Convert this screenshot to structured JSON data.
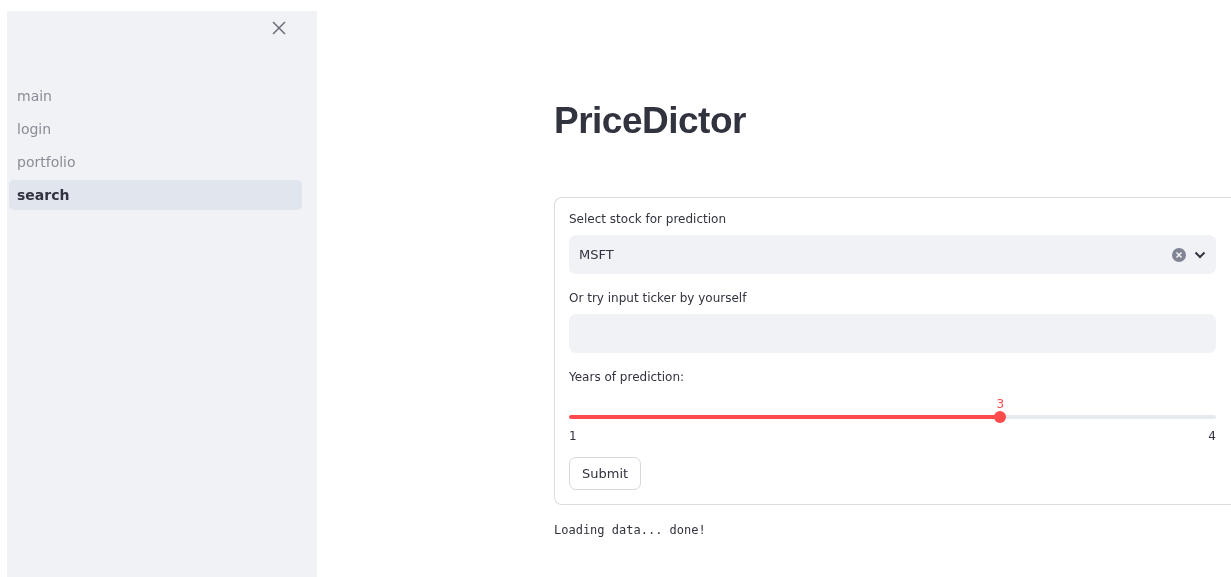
{
  "sidebar": {
    "items": [
      {
        "label": "main",
        "selected": false
      },
      {
        "label": "login",
        "selected": false
      },
      {
        "label": "portfolio",
        "selected": false
      },
      {
        "label": "search",
        "selected": true
      }
    ]
  },
  "title": "PriceDictor",
  "form": {
    "select": {
      "label": "Select stock for prediction",
      "value": "MSFT"
    },
    "ticker": {
      "label": "Or try input ticker by yourself"
    },
    "slider": {
      "label": "Years of prediction:",
      "reading": "3",
      "level": 0.6667,
      "min": "1",
      "max": "4"
    },
    "submit": "Submit"
  },
  "status": "Loading data... done!"
}
